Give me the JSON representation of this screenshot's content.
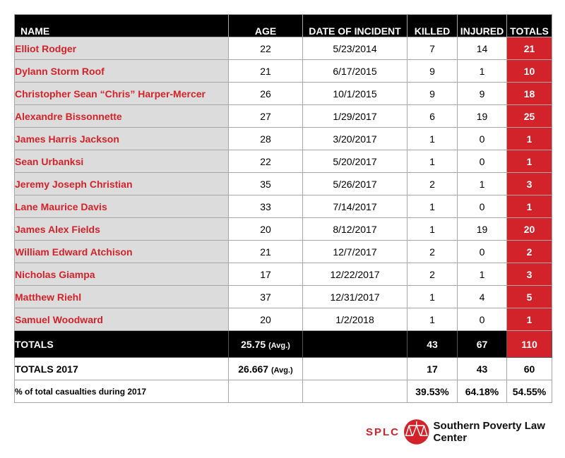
{
  "table": {
    "headers": [
      "NAME",
      "AGE",
      "DATE OF INCIDENT",
      "KILLED",
      "INJURED",
      "TOTALS"
    ],
    "rows": [
      {
        "name": "Elliot Rodger",
        "age": "22",
        "date": "5/23/2014",
        "killed": "7",
        "injured": "14",
        "total": "21"
      },
      {
        "name": "Dylann Storm Roof",
        "age": "21",
        "date": "6/17/2015",
        "killed": "9",
        "injured": "1",
        "total": "10"
      },
      {
        "name": "Christopher Sean “Chris” Harper-Mercer",
        "age": "26",
        "date": "10/1/2015",
        "killed": "9",
        "injured": "9",
        "total": "18"
      },
      {
        "name": "Alexandre Bissonnette",
        "age": "27",
        "date": "1/29/2017",
        "killed": "6",
        "injured": "19",
        "total": "25"
      },
      {
        "name": "James Harris Jackson",
        "age": "28",
        "date": "3/20/2017",
        "killed": "1",
        "injured": "0",
        "total": "1"
      },
      {
        "name": "Sean Urbanksi",
        "age": "22",
        "date": "5/20/2017",
        "killed": "1",
        "injured": "0",
        "total": "1"
      },
      {
        "name": "Jeremy Joseph Christian",
        "age": "35",
        "date": "5/26/2017",
        "killed": "2",
        "injured": "1",
        "total": "3"
      },
      {
        "name": "Lane Maurice Davis",
        "age": "33",
        "date": "7/14/2017",
        "killed": "1",
        "injured": "0",
        "total": "1"
      },
      {
        "name": "James Alex Fields",
        "age": "20",
        "date": "8/12/2017",
        "killed": "1",
        "injured": "19",
        "total": "20"
      },
      {
        "name": "William Edward Atchison",
        "age": "21",
        "date": "12/7/2017",
        "killed": "2",
        "injured": "0",
        "total": "2"
      },
      {
        "name": "Nicholas Giampa",
        "age": "17",
        "date": "12/22/2017",
        "killed": "2",
        "injured": "1",
        "total": "3"
      },
      {
        "name": "Matthew Riehl",
        "age": "37",
        "date": "12/31/2017",
        "killed": "1",
        "injured": "4",
        "total": "5"
      },
      {
        "name": "Samuel Woodward",
        "age": "20",
        "date": "1/2/2018",
        "killed": "1",
        "injured": "0",
        "total": "1"
      }
    ],
    "totals": {
      "label": "TOTALS",
      "age": "25.75",
      "avg": "(Avg.)",
      "killed": "43",
      "injured": "67",
      "total": "110"
    },
    "totals_2017": {
      "label": "TOTALS 2017",
      "age": "26.667",
      "avg": "(Avg.)",
      "killed": "17",
      "injured": "43",
      "total": "60"
    },
    "pct_2017": {
      "label": "% of total casualties during 2017",
      "killed": "39.53%",
      "injured": "64.18%",
      "total": "54.55%"
    }
  },
  "logo": {
    "abbr": "SPLC",
    "name": "Southern Poverty Law Center"
  },
  "colors": {
    "accent": "#d2232a",
    "header": "#000000",
    "name_bg": "#dcdcdc"
  }
}
